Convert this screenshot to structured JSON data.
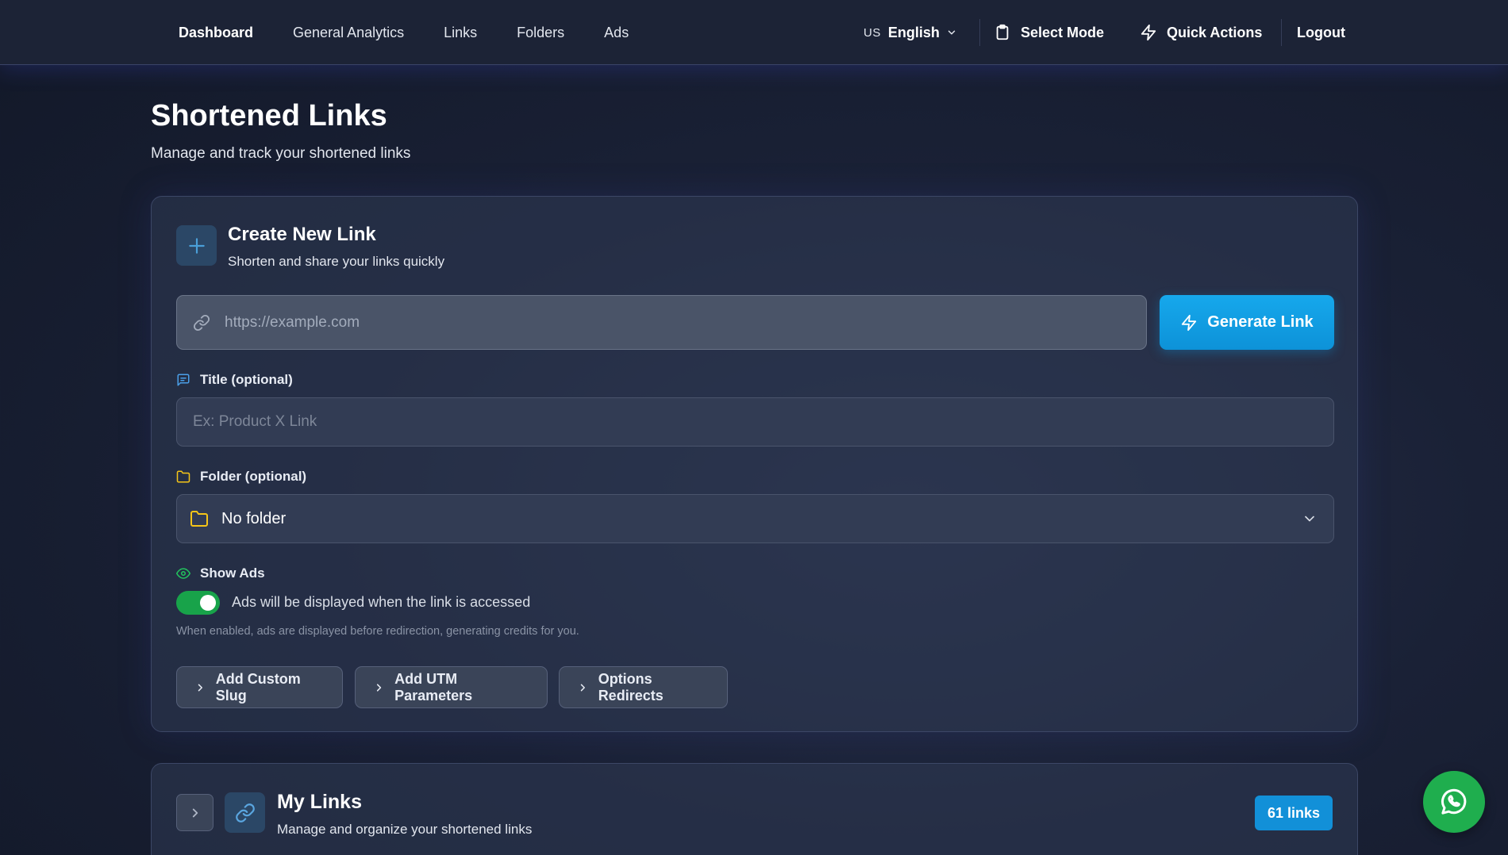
{
  "nav": {
    "links": [
      {
        "label": "Dashboard"
      },
      {
        "label": "General Analytics"
      },
      {
        "label": "Links"
      },
      {
        "label": "Folders"
      },
      {
        "label": "Ads"
      }
    ],
    "language": {
      "flag": "US",
      "label": "English"
    },
    "select_mode": "Select Mode",
    "quick_actions": "Quick Actions",
    "logout": "Logout"
  },
  "page": {
    "title": "Shortened Links",
    "subtitle": "Manage and track your shortened links"
  },
  "create": {
    "title": "Create New Link",
    "subtitle": "Shorten and share your links quickly",
    "url_placeholder": "https://example.com",
    "generate_label": "Generate Link",
    "title_label": "Title (optional)",
    "title_placeholder": "Ex: Product X Link",
    "folder_label": "Folder (optional)",
    "folder_value": "No folder",
    "show_ads_label": "Show Ads",
    "show_ads_enabled": true,
    "show_ads_text": "Ads will be displayed when the link is accessed",
    "show_ads_hint": "When enabled, ads are displayed before redirection, generating credits for you.",
    "options": [
      {
        "label": "Add Custom Slug"
      },
      {
        "label": "Add UTM Parameters"
      },
      {
        "label": "Options Redirects"
      }
    ]
  },
  "my_links": {
    "title": "My Links",
    "subtitle": "Manage and organize your shortened links",
    "count_badge": "61 links"
  },
  "colors": {
    "accent": "#0d92d8",
    "toggle_on": "#18a34a",
    "whatsapp": "#1fae4e",
    "folder_icon": "#f5c518",
    "eye_icon": "#22c55e"
  },
  "icons": {
    "plus": "plus-icon",
    "link": "link-icon",
    "zap": "zap-icon",
    "message": "message-icon",
    "folder": "folder-icon",
    "eye": "eye-icon",
    "chevron": "chevron-right-icon",
    "clipboard": "clipboard-icon",
    "whatsapp": "whatsapp-icon"
  }
}
